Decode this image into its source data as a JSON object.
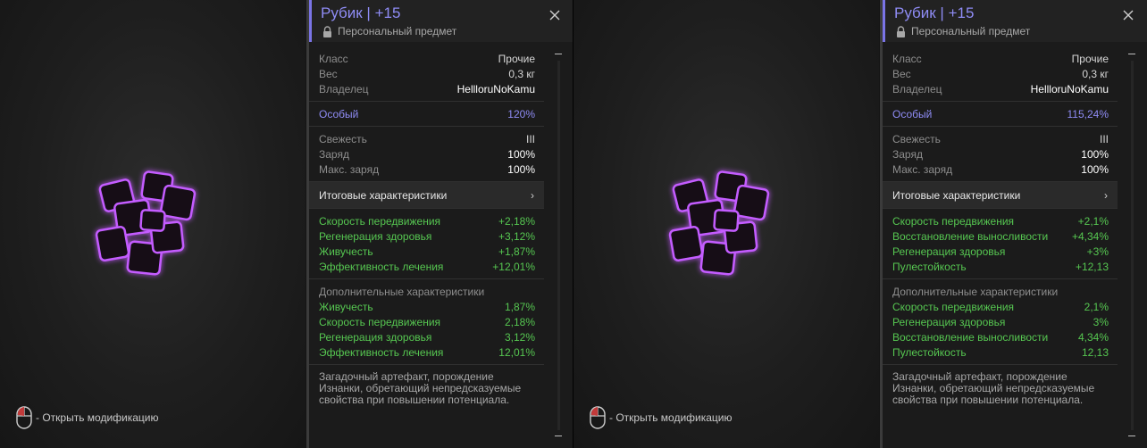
{
  "colors": {
    "accent_purple": "#8f8cf5",
    "stat_green": "#56c751",
    "panel_bg": "#1b1b1b",
    "viewer_bg": "#1e1e1e",
    "glow_purple": "#b84cff"
  },
  "icons": [
    "mouse-icon",
    "lock-icon",
    "close-icon",
    "chevron-right-icon",
    "cube-artifact-icon"
  ],
  "panels": [
    {
      "hint": "- Открыть модификацию",
      "name": "Рубик | +15",
      "personal": "Персональный предмет",
      "info": [
        {
          "label": "Класс",
          "value": "Прочие"
        },
        {
          "label": "Вес",
          "value": "0,3 кг"
        },
        {
          "label": "Владелец",
          "value": "HellloruNoKamu"
        }
      ],
      "special": {
        "label": "Особый",
        "value": "120%"
      },
      "condition": [
        {
          "label": "Свежесть",
          "value": "III"
        },
        {
          "label": "Заряд",
          "value": "100%"
        },
        {
          "label": "Макс. заряд",
          "value": "100%"
        }
      ],
      "final_header": "Итоговые характеристики",
      "final_chevron": "›",
      "final_stats": [
        {
          "label": "Скорость передвижения",
          "value": "+2,18%"
        },
        {
          "label": "Регенерация здоровья",
          "value": "+3,12%"
        },
        {
          "label": "Живучесть",
          "value": "+1,87%"
        },
        {
          "label": "Эффективность лечения",
          "value": "+12,01%"
        }
      ],
      "extra_header": "Дополнительные характеристики",
      "extra_stats": [
        {
          "label": "Живучесть",
          "value": "1,87%"
        },
        {
          "label": "Скорость передвижения",
          "value": "2,18%"
        },
        {
          "label": "Регенерация здоровья",
          "value": "3,12%"
        },
        {
          "label": "Эффективность лечения",
          "value": "12,01%"
        }
      ],
      "description": "Загадочный артефакт, порождение Изнанки, обретающий непредсказуемые свойства при повышении потенциала."
    },
    {
      "hint": "- Открыть модификацию",
      "name": "Рубик | +15",
      "personal": "Персональный предмет",
      "info": [
        {
          "label": "Класс",
          "value": "Прочие"
        },
        {
          "label": "Вес",
          "value": "0,3 кг"
        },
        {
          "label": "Владелец",
          "value": "HellloruNoKamu"
        }
      ],
      "special": {
        "label": "Особый",
        "value": "115,24%"
      },
      "condition": [
        {
          "label": "Свежесть",
          "value": "III"
        },
        {
          "label": "Заряд",
          "value": "100%"
        },
        {
          "label": "Макс. заряд",
          "value": "100%"
        }
      ],
      "final_header": "Итоговые характеристики",
      "final_chevron": "›",
      "final_stats": [
        {
          "label": "Скорость передвижения",
          "value": "+2,1%"
        },
        {
          "label": "Восстановление выносливости",
          "value": "+4,34%"
        },
        {
          "label": "Регенерация здоровья",
          "value": "+3%"
        },
        {
          "label": "Пулестойкость",
          "value": "+12,13"
        }
      ],
      "extra_header": "Дополнительные характеристики",
      "extra_stats": [
        {
          "label": "Скорость передвижения",
          "value": "2,1%"
        },
        {
          "label": "Регенерация здоровья",
          "value": "3%"
        },
        {
          "label": "Восстановление выносливости",
          "value": "4,34%"
        },
        {
          "label": "Пулестойкость",
          "value": "12,13"
        }
      ],
      "description": "Загадочный артефакт, порождение Изнанки, обретающий непредсказуемые свойства при повышении потенциала."
    }
  ]
}
